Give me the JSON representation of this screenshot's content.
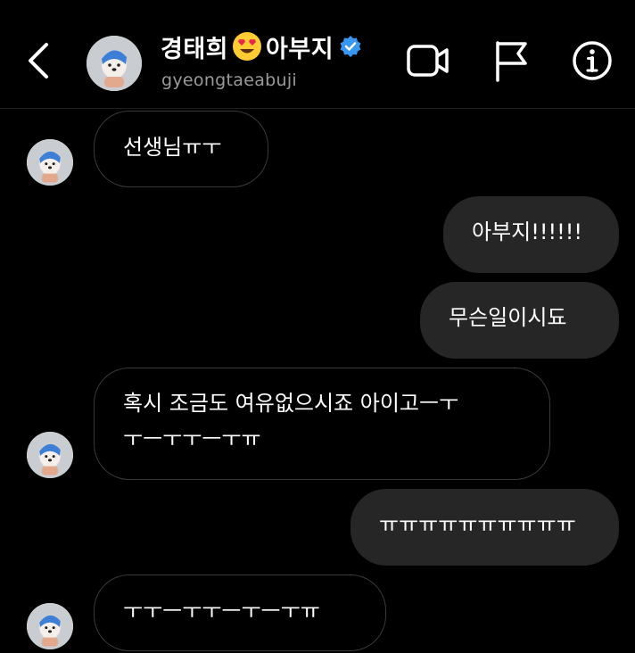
{
  "header": {
    "back_icon": "chevron-left-icon",
    "contact_name_part1": "경태희",
    "contact_emoji": "heart-eyes-emoji",
    "contact_name_part2": "아부지",
    "verified_icon": "verified-badge-icon",
    "username": "gyeongtaeabuji",
    "video_call_icon": "video-camera-icon",
    "report_icon": "flag-icon",
    "info_icon": "info-icon"
  },
  "messages": [
    {
      "direction": "received",
      "text": "선생님ㅠㅜ"
    },
    {
      "direction": "sent",
      "text": "아부지!!!!!!"
    },
    {
      "direction": "sent",
      "text": "무슨일이시됴"
    },
    {
      "direction": "received",
      "lines": [
        "혹시 조금도 여유없으시죠 아이고ㅡㅜ",
        "ㅜㅡㅜㅜㅡㅜㅠ"
      ]
    },
    {
      "direction": "sent",
      "text": "ㅠㅠㅠㅠㅠㅠㅠㅠㅠㅠ"
    },
    {
      "direction": "received",
      "text": "ㅜㅜㅡㅜㅜㅡㅜㅡㅜㅠ"
    }
  ],
  "colors": {
    "background": "#000000",
    "sent_bubble": "#262626",
    "received_bubble_border": "#3a3a3a",
    "verified_blue": "#3897f0",
    "secondary_text": "#9a9a9a"
  }
}
